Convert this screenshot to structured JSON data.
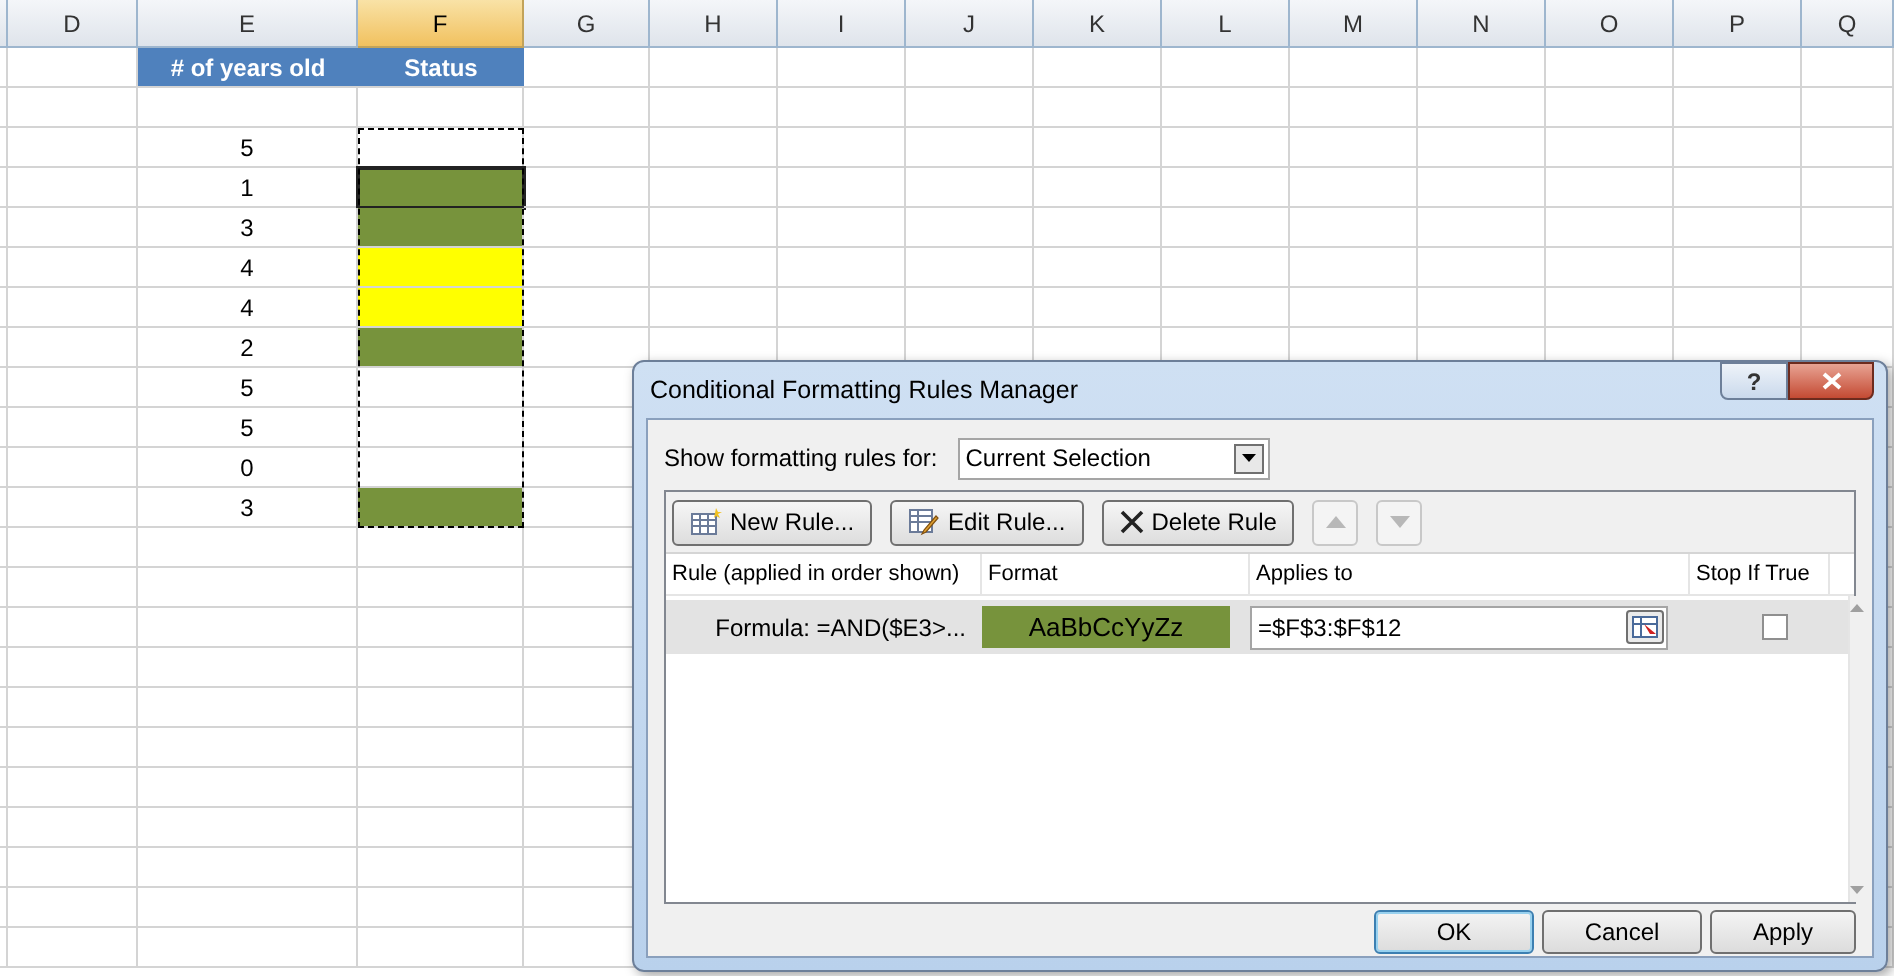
{
  "columns": [
    {
      "label": "D",
      "selected": false
    },
    {
      "label": "E",
      "selected": false
    },
    {
      "label": "F",
      "selected": true
    },
    {
      "label": "G",
      "selected": false
    },
    {
      "label": "H",
      "selected": false
    },
    {
      "label": "I",
      "selected": false
    },
    {
      "label": "J",
      "selected": false
    },
    {
      "label": "K",
      "selected": false
    },
    {
      "label": "L",
      "selected": false
    },
    {
      "label": "M",
      "selected": false
    },
    {
      "label": "N",
      "selected": false
    },
    {
      "label": "O",
      "selected": false
    },
    {
      "label": "P",
      "selected": false
    },
    {
      "label": "Q",
      "selected": false
    }
  ],
  "table_headers": [
    "# of years old",
    "Status"
  ],
  "rows": [
    {
      "years": "5",
      "color": "#ffffff",
      "selected": false
    },
    {
      "years": "1",
      "color": "#77933c",
      "selected": true
    },
    {
      "years": "3",
      "color": "#77933c",
      "selected": false
    },
    {
      "years": "4",
      "color": "#ffff00",
      "selected": false
    },
    {
      "years": "4",
      "color": "#ffff00",
      "selected": false
    },
    {
      "years": "2",
      "color": "#77933c",
      "selected": false
    },
    {
      "years": "5",
      "color": "#ffffff",
      "selected": false
    },
    {
      "years": "5",
      "color": "#ffffff",
      "selected": false
    },
    {
      "years": "0",
      "color": "#ffffff",
      "selected": false
    },
    {
      "years": "3",
      "color": "#77933c",
      "selected": false
    }
  ],
  "dialog": {
    "title": "Conditional Formatting Rules Manager",
    "help": "?",
    "show_label": "Show formatting rules for:",
    "show_value": "Current Selection",
    "toolbar": [
      {
        "label": "New Rule...",
        "kind": "new",
        "disabled": false
      },
      {
        "label": "Edit Rule...",
        "kind": "edit",
        "disabled": false
      },
      {
        "label": "Delete Rule",
        "kind": "delete",
        "disabled": false
      },
      {
        "kind": "up",
        "disabled": true
      },
      {
        "kind": "down",
        "disabled": true
      }
    ],
    "columns": [
      "Rule (applied in order shown)",
      "Format",
      "Applies to",
      "Stop If True"
    ],
    "rules": [
      {
        "rule": "Formula: =AND($E3>...",
        "format": "AaBbCcYyZz",
        "color": "#77933c",
        "applies_to": "=$F$3:$F$12",
        "stop_if_true": false,
        "selected": true
      }
    ],
    "buttons": [
      {
        "label": "OK",
        "default": true
      },
      {
        "label": "Cancel",
        "default": false
      },
      {
        "label": "Apply",
        "default": false
      }
    ]
  }
}
